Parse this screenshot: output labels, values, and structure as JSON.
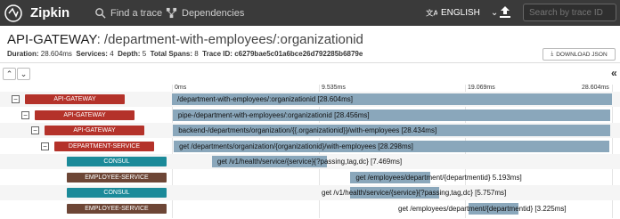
{
  "header": {
    "brand": "Zipkin",
    "nav_find": "Find a trace",
    "nav_deps": "Dependencies",
    "language": "ENGLISH",
    "search_placeholder": "Search by trace ID"
  },
  "trace": {
    "service": "API-GATEWAY",
    "span_name": ": /department-with-employees/:organizationid",
    "duration_label": "Duration:",
    "duration": "28.604ms",
    "services_label": "Services:",
    "services": "4",
    "depth_label": "Depth:",
    "depth": "5",
    "total_spans_label": "Total Spans:",
    "total_spans": "8",
    "trace_id_label": "Trace ID:",
    "trace_id": "c6279bae5c01a6bce26d792285b6879e",
    "download": "DOWNLOAD JSON"
  },
  "timeline": {
    "ticks": [
      "0ms",
      "9.535ms",
      "19.069ms",
      "28.604ms"
    ],
    "total_ms": 28.604
  },
  "colors": {
    "api_gateway": "#b4322a",
    "department_service": "#b4322a",
    "consul": "#1b8a99",
    "employee_service": "#6d4636",
    "bar": "#8aa7bb"
  },
  "spans": [
    {
      "service": "API-GATEWAY",
      "label": "/department-with-employees/:organizationid [28.604ms]",
      "start": 0.0,
      "duration": 28.604,
      "depth": 0,
      "color": "#b4322a",
      "toggle": "−"
    },
    {
      "service": "API-GATEWAY",
      "label": "pipe-/department-with-employees/:organizationid [28.456ms]",
      "start": 0.05,
      "duration": 28.456,
      "depth": 1,
      "color": "#b4322a",
      "toggle": "−"
    },
    {
      "service": "API-GATEWAY",
      "label": "backend-/departments/organization/{{.organizationid}}/with-employees [28.434ms]",
      "start": 0.07,
      "duration": 28.434,
      "depth": 2,
      "color": "#b4322a",
      "toggle": "−"
    },
    {
      "service": "DEPARTMENT-SERVICE",
      "label": "get /departments/organization/{organizationid}/with-employees [28.298ms]",
      "start": 0.12,
      "duration": 28.298,
      "depth": 3,
      "color": "#b4322a",
      "toggle": "−"
    },
    {
      "service": "CONSUL",
      "label": "get /v1/health/service/{service}{?passing,tag,dc} [7.469ms]",
      "start": 2.6,
      "duration": 7.469,
      "depth": 4,
      "color": "#1b8a99",
      "toggle": ""
    },
    {
      "service": "EMPLOYEE-SERVICE",
      "label": "get /employees/department/{departmentid} 5.193ms]",
      "start": 11.6,
      "duration": 5.193,
      "depth": 4,
      "color": "#6d4636",
      "toggle": ""
    },
    {
      "service": "CONSUL",
      "label": "get /v1/health/service/{service}{?passing,tag,dc} [5.757ms]",
      "start": 11.6,
      "duration": 5.757,
      "depth": 4,
      "color": "#1b8a99",
      "toggle": ""
    },
    {
      "service": "EMPLOYEE-SERVICE",
      "label": "get /employees/department/{departmentid} [3.225ms]",
      "start": 19.3,
      "duration": 3.225,
      "depth": 4,
      "color": "#6d4636",
      "toggle": ""
    }
  ]
}
